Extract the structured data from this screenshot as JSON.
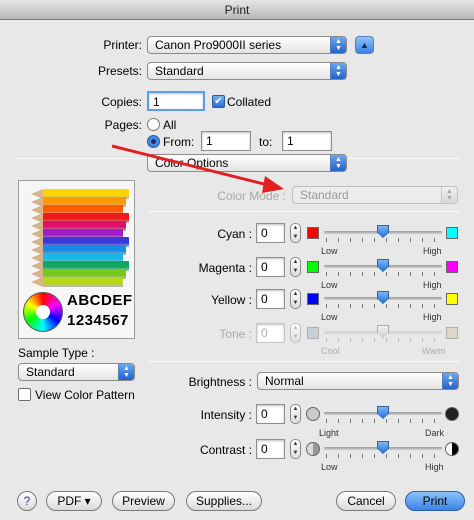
{
  "window": {
    "title": "Print"
  },
  "printer": {
    "label": "Printer:",
    "value": "Canon Pro9000II series"
  },
  "presets": {
    "label": "Presets:",
    "value": "Standard"
  },
  "copies": {
    "label": "Copies:",
    "value": "1",
    "collated_label": "Collated",
    "collated": true
  },
  "pages": {
    "label": "Pages:",
    "all_label": "All",
    "from_label": "From:",
    "from_value": "1",
    "to_label": "to:",
    "to_value": "1"
  },
  "section": {
    "value": "Color Options"
  },
  "color_mode": {
    "label": "Color Mode :",
    "value": "Standard"
  },
  "preview": {
    "letters": "ABCDEF",
    "digits": "1234567",
    "pencil_colors": [
      "#ffd400",
      "#ff9a00",
      "#ff5a00",
      "#f01818",
      "#e0106a",
      "#a01ec8",
      "#3a3ad8",
      "#168ae6",
      "#18b8e6",
      "#10a860",
      "#76c81c",
      "#b8d818"
    ]
  },
  "sample_type": {
    "label": "Sample Type :",
    "value": "Standard"
  },
  "view_pattern": {
    "label": "View Color Pattern",
    "checked": false
  },
  "cyan": {
    "label": "Cyan :",
    "value": "0",
    "low": "Low",
    "high": "High",
    "left_color": "#ff0000",
    "right_color": "#00ffff",
    "level": 0.5
  },
  "magenta": {
    "label": "Magenta :",
    "value": "0",
    "low": "Low",
    "high": "High",
    "left_color": "#00ff00",
    "right_color": "#ff00ff",
    "level": 0.5
  },
  "yellow": {
    "label": "Yellow :",
    "value": "0",
    "low": "Low",
    "high": "High",
    "left_color": "#0000ff",
    "right_color": "#ffff00",
    "level": 0.5
  },
  "tone": {
    "label": "Tone :",
    "value": "0",
    "low": "Cool",
    "high": "Warm",
    "level": 0.5
  },
  "brightness": {
    "label": "Brightness :",
    "value": "Normal"
  },
  "intensity": {
    "label": "Intensity :",
    "value": "0",
    "low": "Light",
    "high": "Dark",
    "level": 0.5
  },
  "contrast": {
    "label": "Contrast :",
    "value": "0",
    "low": "Low",
    "high": "High",
    "level": 0.5
  },
  "buttons": {
    "help": "?",
    "pdf": "PDF ▾",
    "preview": "Preview",
    "supplies": "Supplies...",
    "cancel": "Cancel",
    "print": "Print"
  },
  "annotation": {
    "arrow_color": "#e32020"
  }
}
